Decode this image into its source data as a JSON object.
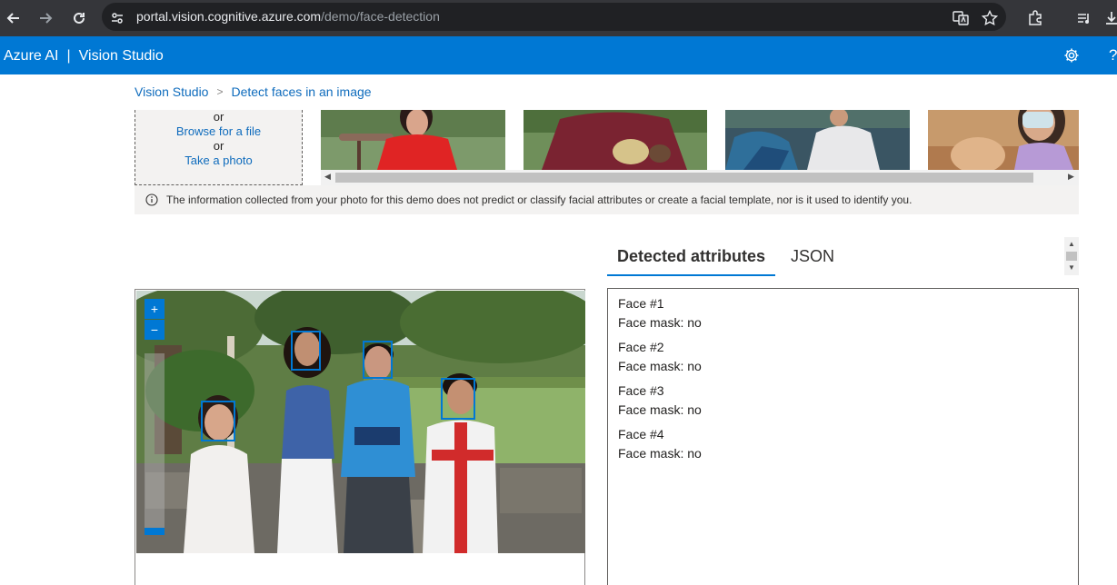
{
  "browser": {
    "url_host": "portal.vision.cognitive.azure.com",
    "url_path": "/demo/face-detection"
  },
  "app": {
    "brand": "Azure AI",
    "separator": "|",
    "product": "Vision Studio",
    "help_glyph": "?"
  },
  "breadcrumb": {
    "items": [
      "Vision Studio",
      "Detect faces in an image"
    ],
    "separator": ">"
  },
  "upload": {
    "or_1": "or",
    "browse_label": "Browse for a file",
    "or_2": "or",
    "photo_label": "Take a photo"
  },
  "notice": {
    "text": "The information collected from your photo for this demo does not predict or classify facial attributes or create a facial template, nor is it used to identify you."
  },
  "tabs": [
    {
      "label": "Detected attributes",
      "active": true
    },
    {
      "label": "JSON",
      "active": false
    }
  ],
  "zoom": {
    "in_glyph": "+",
    "out_glyph": "−"
  },
  "results": [
    {
      "title": "Face #1",
      "attribute": "Face mask: no"
    },
    {
      "title": "Face #2",
      "attribute": "Face mask: no"
    },
    {
      "title": "Face #3",
      "attribute": "Face mask: no"
    },
    {
      "title": "Face #4",
      "attribute": "Face mask: no"
    }
  ],
  "colors": {
    "accent": "#0078d4",
    "link": "#0f6cbd",
    "chrome": "#35363a"
  },
  "icons": [
    "back-icon",
    "forward-icon",
    "reload-icon",
    "site-settings-icon",
    "translate-icon",
    "star-icon",
    "extensions-icon",
    "media-icon",
    "download-icon",
    "gear-icon",
    "help-icon",
    "info-icon"
  ]
}
